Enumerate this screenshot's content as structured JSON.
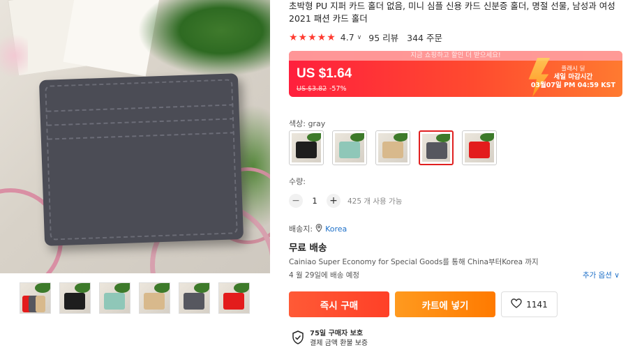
{
  "product": {
    "title": "초박형 PU 지퍼 카드 홀더 없음, 미니 심플 신용 카드 신분증 홀더, 명절 선물, 남성과 여성 2021 패션 카드 홀더",
    "rating": "4.7",
    "stars": "★★★★★",
    "reviews": "95 리뷰",
    "orders": "344 주문"
  },
  "price": {
    "banner": "지금 쇼핑하고 할인 더 받으세요!",
    "current": "US $1.64",
    "original": "US $3.82",
    "discount": "-57%",
    "flash_line1": "플래시 딜",
    "flash_line2": "세일 마감시간",
    "flash_time": "03월07일 PM 04:59 KST"
  },
  "variant": {
    "color_label": "색상: gray",
    "options": [
      {
        "name": "black",
        "hex": "#1e1e1e"
      },
      {
        "name": "mint",
        "hex": "#8fc7b8"
      },
      {
        "name": "khaki",
        "hex": "#d8b98c"
      },
      {
        "name": "gray",
        "hex": "#56575f",
        "selected": true
      },
      {
        "name": "red",
        "hex": "#e31c1c"
      }
    ]
  },
  "quantity": {
    "label": "수량:",
    "value": "1",
    "minus": "−",
    "plus": "+",
    "available": "425 개 사용 가능"
  },
  "shipping": {
    "ship_to_label": "배송지:",
    "location": "Korea",
    "free": "무료 배송",
    "detail": "Cainiao Super Economy for Special Goods를 통해 China부터Korea 까지",
    "date": "4 월 29일에 배송 예정",
    "more": "추가 옵션 ∨"
  },
  "actions": {
    "buy": "즉시 구매",
    "cart": "카트에 넣기",
    "wishlist_count": "1141"
  },
  "protection": {
    "title": "75일 구매자 보호",
    "subtitle": "결제 금액 환불 보증"
  },
  "gallery": {
    "thumbnails": [
      "mix",
      "black",
      "mint",
      "khaki",
      "gray",
      "red"
    ]
  },
  "colors": {
    "accent_red": "#ff3b30",
    "link_blue": "#1e70c8",
    "buy": "#ff4a2b",
    "cart": "#ff8a00"
  }
}
